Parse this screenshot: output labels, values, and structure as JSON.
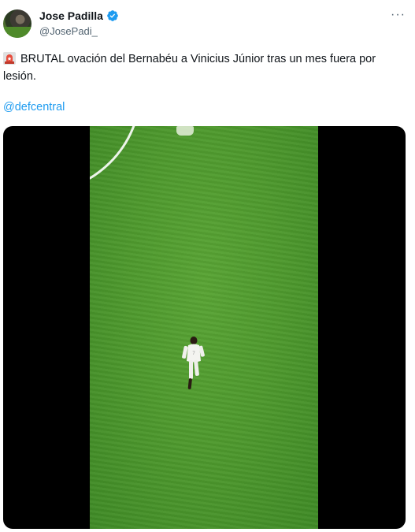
{
  "author": {
    "name": "Jose Padilla",
    "handle": "@JosePadi_",
    "verified_color": "#1d9bf0"
  },
  "menu": {
    "more_label": "···"
  },
  "post": {
    "emoji_icon": "siren-icon",
    "text": "BRUTAL ovación del Bernabéu a Vinicius Júnior tras un mes fuera por lesión.",
    "mention": "@defcentral"
  },
  "media": {
    "type": "video",
    "content": "football-pitch-player",
    "background_color": "#000000",
    "pitch_color": "#4f9a2e"
  }
}
